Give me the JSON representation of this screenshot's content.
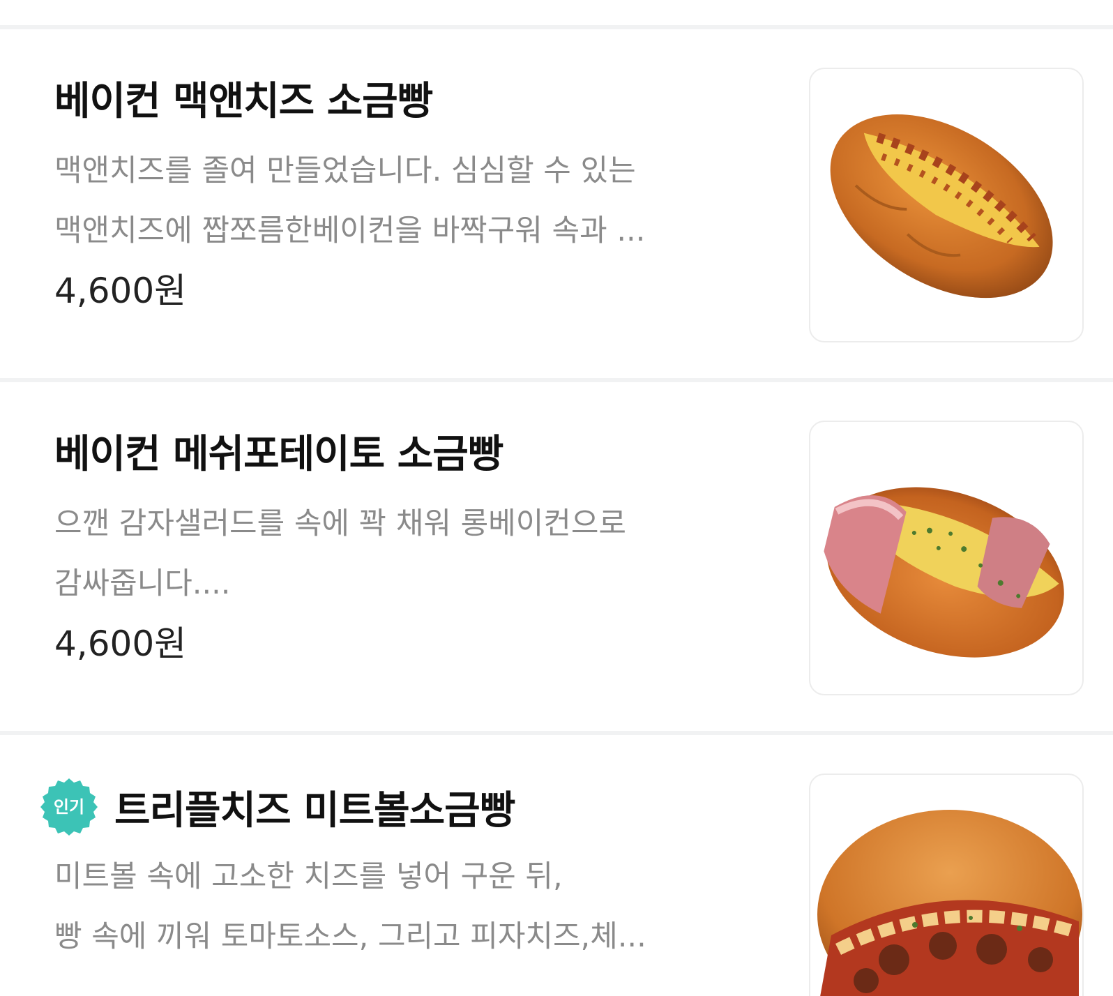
{
  "items": [
    {
      "title": "베이컨 맥앤치즈 소금빵",
      "desc_lines": [
        "맥앤치즈를 졸여 만들었습니다. 심심할 수 있는",
        "맥앤치즈에 짭쪼름한베이컨을 바짝구워 속과 ..."
      ],
      "price": "4,600원",
      "image": "bacon-mac-cheese-salt-bread"
    },
    {
      "title": "베이컨 메쉬포테이토 소금빵",
      "desc_lines": [
        "으깬 감자샐러드를 속에 꽉 채워 롱베이컨으로",
        "감싸줍니다...."
      ],
      "price": "4,600원",
      "image": "bacon-mashed-potato-salt-bread"
    },
    {
      "badge": "인기",
      "badge_color": "#3cc3b6",
      "title": "트리플치즈 미트볼소금빵",
      "desc_lines": [
        "미트볼 속에 고소한 치즈를 넣어 구운 뒤,",
        " 빵 속에 끼워 토마토소스, 그리고 피자치즈,체..."
      ],
      "image": "triple-cheese-meatball-salt-bread"
    }
  ]
}
